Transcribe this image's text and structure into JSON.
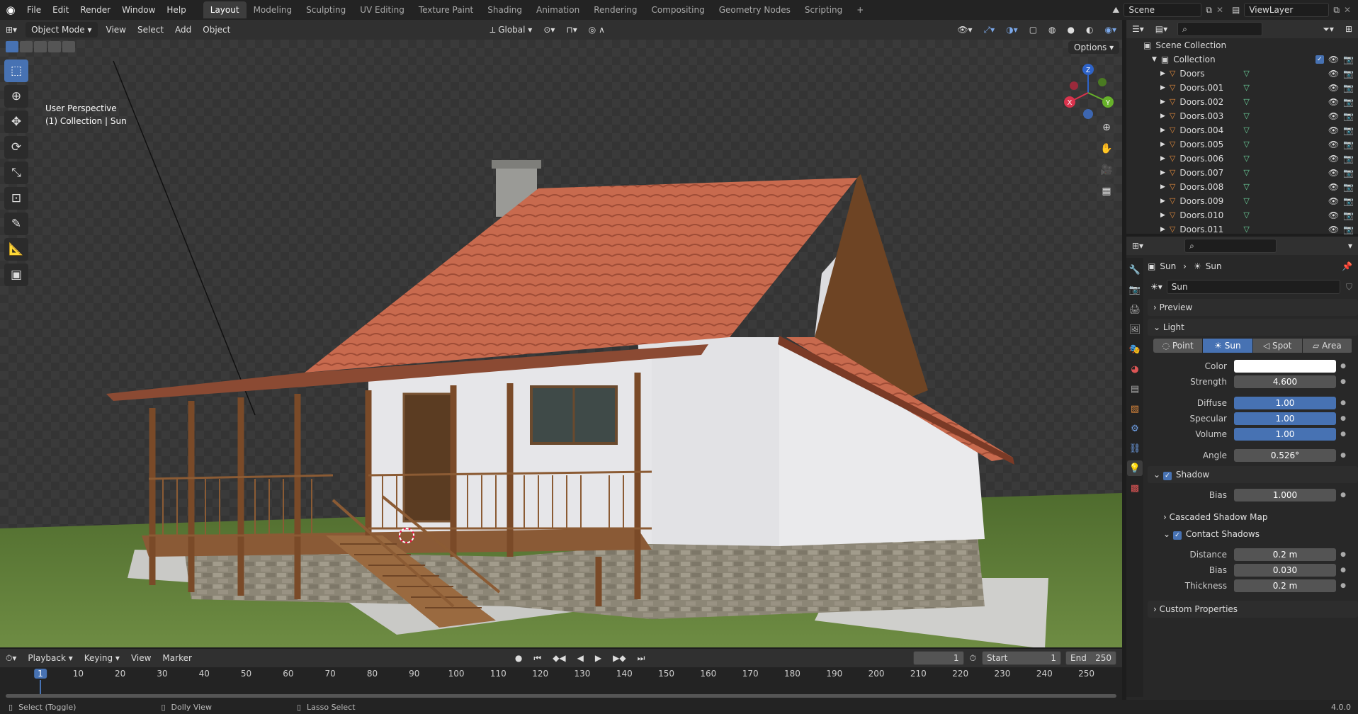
{
  "menu": [
    "File",
    "Edit",
    "Render",
    "Window",
    "Help"
  ],
  "workspaces": [
    "Layout",
    "Modeling",
    "Sculpting",
    "UV Editing",
    "Texture Paint",
    "Shading",
    "Animation",
    "Rendering",
    "Compositing",
    "Geometry Nodes",
    "Scripting"
  ],
  "scene": {
    "name": "Scene",
    "view_layer": "ViewLayer"
  },
  "viewport_header": {
    "mode": "Object Mode",
    "menus": [
      "View",
      "Select",
      "Add",
      "Object"
    ],
    "orientation": "Global",
    "options": "Options"
  },
  "viewport_info": {
    "line1": "User Perspective",
    "line2": "(1) Collection | Sun"
  },
  "gizmo": {
    "x": "X",
    "y": "Y",
    "z": "Z"
  },
  "outliner": {
    "root": "Scene Collection",
    "collection": "Collection",
    "items": [
      "Doors",
      "Doors.001",
      "Doors.002",
      "Doors.003",
      "Doors.004",
      "Doors.005",
      "Doors.006",
      "Doors.007",
      "Doors.008",
      "Doors.009",
      "Doors.010",
      "Doors.011"
    ]
  },
  "properties": {
    "breadcrumb": [
      "Sun",
      "Sun"
    ],
    "data_name": "Sun",
    "panels": {
      "preview": "Preview",
      "light": "Light",
      "shadow": "Shadow",
      "cascaded": "Cascaded Shadow Map",
      "contact": "Contact Shadows",
      "custom": "Custom Properties"
    },
    "light_types": [
      "Point",
      "Sun",
      "Spot",
      "Area"
    ],
    "light_active": "Sun",
    "light_props": [
      {
        "label": "Color",
        "value": ""
      },
      {
        "label": "Strength",
        "value": "4.600"
      },
      {
        "label": "Diffuse",
        "value": "1.00"
      },
      {
        "label": "Specular",
        "value": "1.00"
      },
      {
        "label": "Volume",
        "value": "1.00"
      },
      {
        "label": "Angle",
        "value": "0.526°"
      }
    ],
    "shadow_bias": {
      "label": "Bias",
      "value": "1.000"
    },
    "contact_props": [
      {
        "label": "Distance",
        "value": "0.2 m"
      },
      {
        "label": "Bias",
        "value": "0.030"
      },
      {
        "label": "Thickness",
        "value": "0.2 m"
      }
    ]
  },
  "timeline": {
    "menus": [
      "Playback",
      "Keying",
      "View",
      "Marker"
    ],
    "current_frame": "1",
    "start_label": "Start",
    "start": "1",
    "end_label": "End",
    "end": "250",
    "ticks": [
      "1",
      "10",
      "20",
      "30",
      "40",
      "50",
      "60",
      "70",
      "80",
      "90",
      "100",
      "110",
      "120",
      "130",
      "140",
      "150",
      "160",
      "170",
      "180",
      "190",
      "200",
      "210",
      "220",
      "230",
      "240",
      "250"
    ]
  },
  "status": {
    "left": "Select (Toggle)",
    "mid": "Dolly View",
    "right": "Lasso Select",
    "version": "4.0.0"
  },
  "colors": {
    "accent": "#4772b3",
    "roof": "#c7644a",
    "grass": "#5b7a36",
    "wall": "#e8e8ea"
  }
}
